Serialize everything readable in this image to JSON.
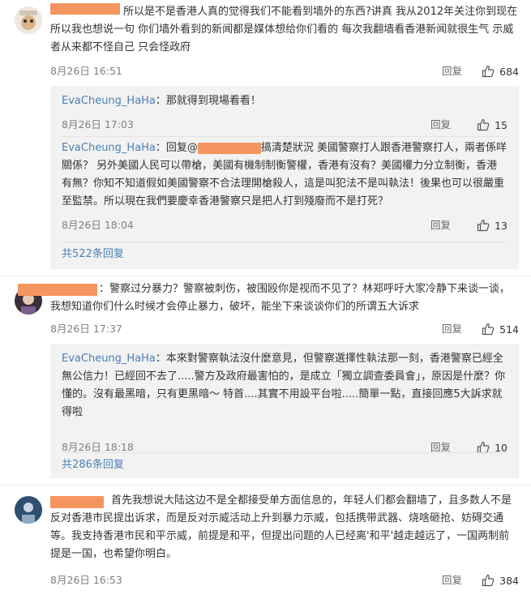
{
  "comments": [
    {
      "text": "所以是不是香港人真的觉得我们不能看到墙外的东西?讲真 我从2012年关注你到现在 所以我也想说一句 你们墙外看到的新闻都是媒体想给你们看的 每次我翻墙看香港新闻就很生气 示威者从来都不怪自己 只会怪政府",
      "time": "8月26日 16:51",
      "reply_label": "回复",
      "likes": "684",
      "sub_replies": [
        {
          "user": "EvaCheung_HaHa",
          "text": "：那就得到現場看看！",
          "time": "8月26日 17:03",
          "reply_label": "回复",
          "likes": "15"
        },
        {
          "user": "EvaCheung_HaHa",
          "prefix": "：回复@",
          "text": "搞清楚狀況 美國警察打人跟香港警察打人，兩者係咩關係？ 另外美國人民可以帶槍，美國有機制制衡警權，香港有沒有？美國權力分立制衡，香港有無？你知不知道假如美國警察不合法理開槍殺人，這是叫犯法不是叫執法！後果也可以很嚴重至監禁。所以現在我們要慶幸香港警察只是把人打到殘廢而不是打死？",
          "time": "8月26日 18:04",
          "reply_label": "回复",
          "likes": "13"
        }
      ],
      "more_label": "共522条回复"
    },
    {
      "text": "：警察过分暴力？警察被刺伤，被围殴你是视而不见了？林郑呼吁大家冷静下来谈一谈，我想知道你们什么时候才会停止暴力，破坏，能坐下来谈谈你们的所谓五大诉求",
      "time": "8月26日 17:37",
      "reply_label": "回复",
      "likes": "514",
      "sub_replies": [
        {
          "user": "EvaCheung_HaHa",
          "text": "：本來對警察執法沒什麼意見，但警察選擇性執法那一刻，香港警察已經全無公信力！已經回不去了.....警方及政府最害怕的，是成立「獨立調查委員會」，原因是什麼？你懂的。沒有最黑暗，只有更黑暗～ 特首....其實不用設平台啦.....簡單一點，直接回應5大訴求就得啦",
          "time": "8月26日 18:18",
          "reply_label": "回复",
          "likes": "10"
        }
      ],
      "more_label": "共286条回复"
    },
    {
      "text": "首先我想说大陆这边不是全都接受单方面信息的，年轻人们都会翻墙了，且多数人不是反对香港市民提出诉求，而是反对示威活动上升到暴力示威，包括携带武器、烧啥砸抢、妨碍交通等。我支持香港市民和平示威，前提是和平，但提出问题的人已经离'和平'越走越远了，一国两制前提是一国，也希望你明白。",
      "time": "8月26日 16:53",
      "reply_label": "回复",
      "likes": "384"
    }
  ],
  "colors": {
    "link": "#4a7fb5",
    "redaction": "#f4955f",
    "sub_background": "#f2f2f2"
  },
  "icons": [
    "avatar",
    "thumbs-up-icon"
  ]
}
